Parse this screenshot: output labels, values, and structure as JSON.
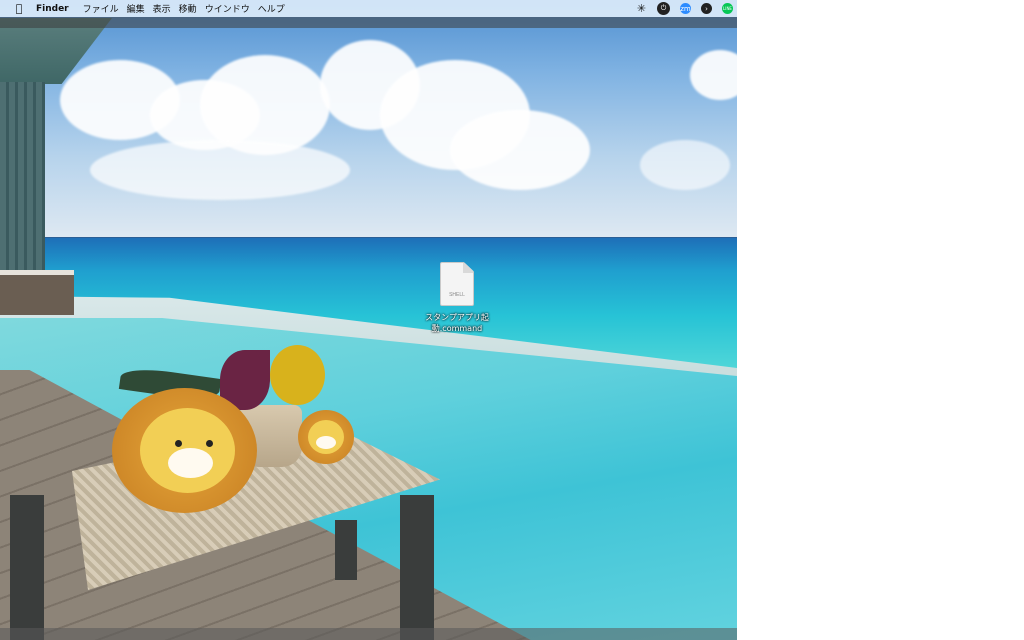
{
  "menubar": {
    "apple": "",
    "app_name": "Finder",
    "items": [
      "ファイル",
      "編集",
      "表示",
      "移動",
      "ウインドウ",
      "ヘルプ"
    ],
    "status_icons": [
      "gear-icon",
      "power-icon",
      "zoom-icon",
      "terminal-icon",
      "line-icon"
    ],
    "status_labels": [
      "zm",
      "LINE"
    ]
  },
  "desktop": {
    "file": {
      "icon_badge": "SHELL",
      "name_line1": "スタンプアプリ起",
      "name_line2": "動.command"
    }
  },
  "colors": {
    "menubar": "#dcecfa",
    "zoom": "#2d8cff",
    "line": "#06c755"
  }
}
